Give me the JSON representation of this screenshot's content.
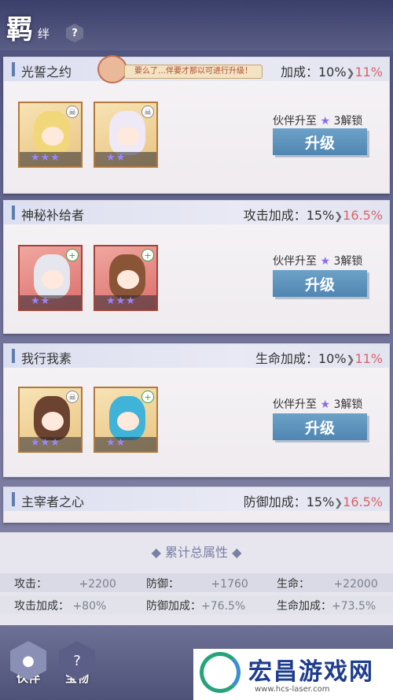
{
  "header": {
    "title_main": "羁",
    "title_sub": "绊",
    "help_glyph": "?"
  },
  "toast": {
    "text": "要么了…伴要才那以可进行升级！"
  },
  "cards": [
    {
      "name": "光誓之约",
      "bonus_label": "",
      "bonus_value": "加成：10%",
      "bonus_next": "11%",
      "unlock_prefix": "伙伴升至",
      "unlock_suffix": "3解锁",
      "button": "升级"
    },
    {
      "name": "神秘补给者",
      "bonus_label": "攻击加成：",
      "bonus_value": "15%",
      "bonus_next": "16.5%",
      "unlock_prefix": "伙伴升至",
      "unlock_suffix": "3解锁",
      "button": "升级"
    },
    {
      "name": "我行我素",
      "bonus_label": "生命加成：",
      "bonus_value": "10%",
      "bonus_next": "11%",
      "unlock_prefix": "伙伴升至",
      "unlock_suffix": "3解锁",
      "button": "升级"
    },
    {
      "name": "主宰者之心",
      "bonus_label": "防御加成：",
      "bonus_value": "15%",
      "bonus_next": "16.5%"
    }
  ],
  "summary": {
    "title": "累计总属性",
    "row1": [
      {
        "label": "攻击：",
        "value": "+2200"
      },
      {
        "label": "防御：",
        "value": "+1760"
      },
      {
        "label": "生命：",
        "value": "+22000"
      }
    ],
    "row2": [
      {
        "label": "攻击加成：",
        "value": "+80%"
      },
      {
        "label": "防御加成：",
        "value": "+76.5%"
      },
      {
        "label": "生命加成：",
        "value": "+73.5%"
      }
    ]
  },
  "nav": {
    "partner": "伙伴",
    "treasure": "宝物"
  },
  "watermark": {
    "title": "宏昌游戏网",
    "url": "www.hcs-laser.com"
  },
  "colors": {
    "accent": "#4f86b2",
    "bonus_next": "#d9636b",
    "star": "#8a6cf0"
  }
}
